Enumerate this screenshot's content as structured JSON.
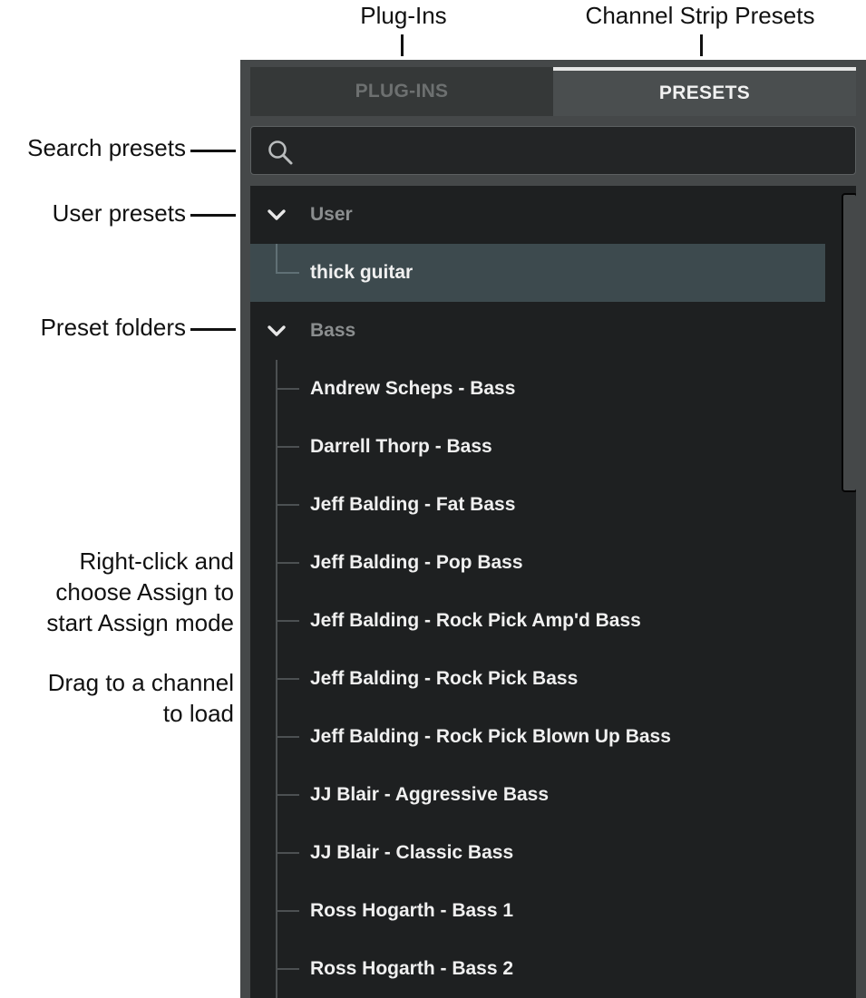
{
  "callouts": {
    "plugins": "Plug-Ins",
    "channel_strip_presets": "Channel Strip Presets",
    "search_presets": "Search presets",
    "user_presets": "User presets",
    "preset_folders": "Preset folders",
    "assign": [
      "Right-click and",
      "choose Assign to",
      "start Assign mode"
    ],
    "drag": [
      "Drag to a channel",
      "to load"
    ]
  },
  "tabs": [
    {
      "label": "PLUG-INS",
      "active": false
    },
    {
      "label": "PRESETS",
      "active": true
    }
  ],
  "search": {
    "value": "",
    "placeholder": "",
    "icon": "search-icon"
  },
  "folders": [
    {
      "name": "User",
      "expanded": true,
      "items": [
        {
          "label": "thick guitar",
          "selected": true
        }
      ]
    },
    {
      "name": "Bass",
      "expanded": true,
      "items": [
        {
          "label": "Andrew Scheps - Bass"
        },
        {
          "label": "Darrell Thorp - Bass"
        },
        {
          "label": "Jeff Balding - Fat Bass"
        },
        {
          "label": "Jeff Balding - Pop Bass"
        },
        {
          "label": "Jeff Balding - Rock Pick Amp'd Bass"
        },
        {
          "label": "Jeff Balding - Rock Pick Bass"
        },
        {
          "label": "Jeff Balding - Rock Pick Blown Up Bass"
        },
        {
          "label": "JJ Blair - Aggressive Bass"
        },
        {
          "label": "JJ Blair - Classic Bass"
        },
        {
          "label": "Ross Hogarth - Bass 1"
        },
        {
          "label": "Ross Hogarth - Bass 2"
        }
      ]
    }
  ],
  "colors": {
    "panel_bg": "#454849",
    "list_bg": "#1e2021",
    "selected_row": "#3d4a4e",
    "tab_active_indicator": "#e6e6e6"
  }
}
